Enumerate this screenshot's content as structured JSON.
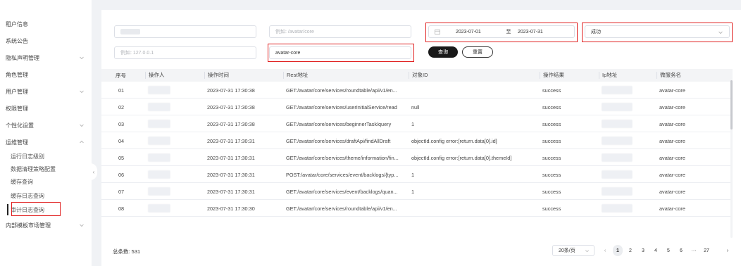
{
  "sidebar": {
    "items": [
      {
        "label": "租户信息",
        "has_chevron": false
      },
      {
        "label": "系统公告",
        "has_chevron": false
      },
      {
        "label": "隐私声明管理",
        "has_chevron": true
      },
      {
        "label": "角色管理",
        "has_chevron": false
      },
      {
        "label": "用户管理",
        "has_chevron": true
      },
      {
        "label": "权限管理",
        "has_chevron": false
      },
      {
        "label": "个性化设置",
        "has_chevron": true
      },
      {
        "label": "运维管理",
        "has_chevron": true,
        "expanded": true
      },
      {
        "label": "内部模板市场管理",
        "has_chevron": true
      }
    ],
    "sub_items": [
      {
        "label": "运行日志级别"
      },
      {
        "label": "数据清理策略配置"
      },
      {
        "label": "缓存查询"
      },
      {
        "label": "缓存日志查询"
      },
      {
        "label": "审计日志查询",
        "active": true
      }
    ]
  },
  "filters": {
    "operator_placeholder": "",
    "rest_placeholder": "例如: /avatar/core",
    "ip_placeholder": "例如: 127.0.0.1",
    "service_value": "avatar-core",
    "date_start": "2023-07-01",
    "date_sep": "至",
    "date_end": "2023-07-31",
    "result_value": "成功",
    "query_label": "查询",
    "reset_label": "重置"
  },
  "table": {
    "columns": [
      "序号",
      "操作人",
      "操作时间",
      "Rest地址",
      "对象ID",
      "操作结果",
      "Ip地址",
      "微服务名"
    ],
    "rows": [
      {
        "idx": "01",
        "time": "2023-07-31 17:30:38",
        "rest": "GET:/avatar/core/services/roundtable/api/v1/en...",
        "obj": "",
        "result": "success",
        "service": "avatar-core"
      },
      {
        "idx": "02",
        "time": "2023-07-31 17:30:38",
        "rest": "GET:/avatar/core/services/userInitialService/read",
        "obj": "null",
        "result": "success",
        "service": "avatar-core"
      },
      {
        "idx": "03",
        "time": "2023-07-31 17:30:38",
        "rest": "GET:/avatar/core/services/beginnerTask/query",
        "obj": "1",
        "result": "success",
        "service": "avatar-core"
      },
      {
        "idx": "04",
        "time": "2023-07-31 17:30:31",
        "rest": "GET:/avatar/core/services/draftApi/findAllDraft",
        "obj": "objectId.config error:[return.data[0].id]",
        "result": "success",
        "service": "avatar-core"
      },
      {
        "idx": "05",
        "time": "2023-07-31 17:30:31",
        "rest": "GET:/avatar/core/services/theme/information/fin...",
        "obj": "objectId.config error:[return.data[0].themeId]",
        "result": "success",
        "service": "avatar-core"
      },
      {
        "idx": "06",
        "time": "2023-07-31 17:30:31",
        "rest": "POST:/avatar/core/services/event/backlogs/{typ...",
        "obj": "1",
        "result": "success",
        "service": "avatar-core"
      },
      {
        "idx": "07",
        "time": "2023-07-31 17:30:31",
        "rest": "GET:/avatar/core/services/event/backlogs/quan...",
        "obj": "1",
        "result": "success",
        "service": "avatar-core"
      },
      {
        "idx": "08",
        "time": "2023-07-31 17:30:30",
        "rest": "GET:/avatar/core/services/roundtable/api/v1/en...",
        "obj": "",
        "result": "success",
        "service": "avatar-core"
      }
    ]
  },
  "footer": {
    "total": "总条数: 531",
    "page_size": "20条/页",
    "prev": "‹",
    "next": "›",
    "pages": [
      "1",
      "2",
      "3",
      "4",
      "5",
      "6",
      "···",
      "27"
    ],
    "current_page": "1"
  },
  "colors": {
    "highlight": "#e02020",
    "primary_button": "#191919"
  }
}
